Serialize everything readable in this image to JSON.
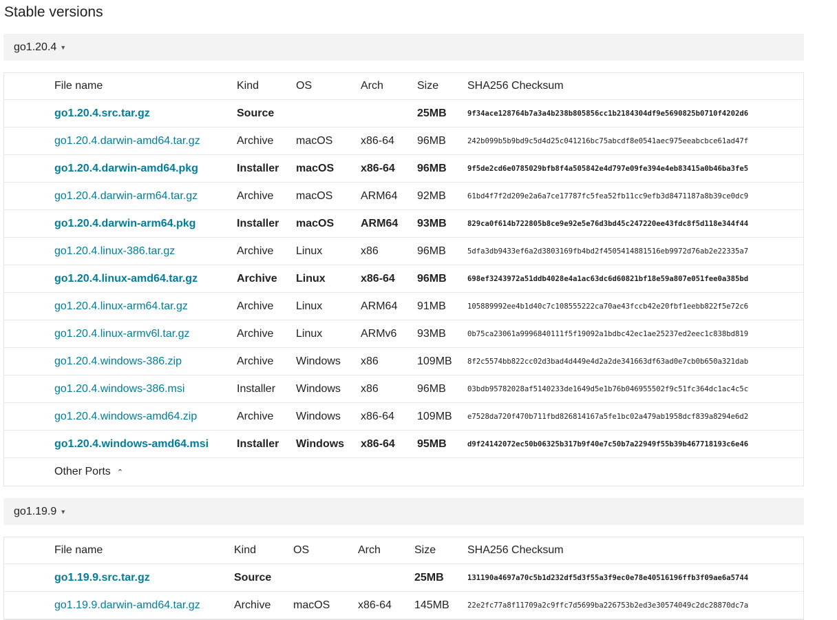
{
  "page_title": "Stable versions",
  "releases": [
    {
      "version": "go1.20.4",
      "columns": [
        "File name",
        "Kind",
        "OS",
        "Arch",
        "Size",
        "SHA256 Checksum"
      ],
      "files": [
        {
          "name": "go1.20.4.src.tar.gz",
          "kind": "Source",
          "os": "",
          "arch": "",
          "size": "25MB",
          "sha": "9f34ace128764b7a3a4b238b805856cc1b2184304df9e5690825b0710f4202d6",
          "featured": true
        },
        {
          "name": "go1.20.4.darwin-amd64.tar.gz",
          "kind": "Archive",
          "os": "macOS",
          "arch": "x86-64",
          "size": "96MB",
          "sha": "242b099b5b9bd9c5d4d25c041216bc75abcdf8e0541aec975eeabcbce61ad47f",
          "featured": false
        },
        {
          "name": "go1.20.4.darwin-amd64.pkg",
          "kind": "Installer",
          "os": "macOS",
          "arch": "x86-64",
          "size": "96MB",
          "sha": "9f5de2cd6e0785029bfb8f4a505842e4d797e09fe394e4eb83415a0b46ba3fe5",
          "featured": true
        },
        {
          "name": "go1.20.4.darwin-arm64.tar.gz",
          "kind": "Archive",
          "os": "macOS",
          "arch": "ARM64",
          "size": "92MB",
          "sha": "61bd4f7f2d209e2a6a7ce17787fc5fea52fb11cc9efb3d8471187a8b39ce0dc9",
          "featured": false
        },
        {
          "name": "go1.20.4.darwin-arm64.pkg",
          "kind": "Installer",
          "os": "macOS",
          "arch": "ARM64",
          "size": "93MB",
          "sha": "829ca0f614b722805b8ce9e92e5e76d3bd45c247220ee43fdc8f5d118e344f44",
          "featured": true
        },
        {
          "name": "go1.20.4.linux-386.tar.gz",
          "kind": "Archive",
          "os": "Linux",
          "arch": "x86",
          "size": "96MB",
          "sha": "5dfa3db9433ef6a2d3803169fb4bd2f4505414881516eb9972d76ab2e22335a7",
          "featured": false
        },
        {
          "name": "go1.20.4.linux-amd64.tar.gz",
          "kind": "Archive",
          "os": "Linux",
          "arch": "x86-64",
          "size": "96MB",
          "sha": "698ef3243972a51ddb4028e4a1ac63dc6d60821bf18e59a807e051fee0a385bd",
          "featured": true
        },
        {
          "name": "go1.20.4.linux-arm64.tar.gz",
          "kind": "Archive",
          "os": "Linux",
          "arch": "ARM64",
          "size": "91MB",
          "sha": "105889992ee4b1d40c7c108555222ca70ae43fccb42e20fbf1eebb822f5e72c6",
          "featured": false
        },
        {
          "name": "go1.20.4.linux-armv6l.tar.gz",
          "kind": "Archive",
          "os": "Linux",
          "arch": "ARMv6",
          "size": "93MB",
          "sha": "0b75ca23061a9996840111f5f19092a1bdbc42ec1ae25237ed2eec1c838bd819",
          "featured": false
        },
        {
          "name": "go1.20.4.windows-386.zip",
          "kind": "Archive",
          "os": "Windows",
          "arch": "x86",
          "size": "109MB",
          "sha": "8f2c5574bb822cc02d3bad4d449e4d2a2de341663df63ad0e7cb0b650a321dab",
          "featured": false
        },
        {
          "name": "go1.20.4.windows-386.msi",
          "kind": "Installer",
          "os": "Windows",
          "arch": "x86",
          "size": "96MB",
          "sha": "03bdb95782028af5140233de1649d5e1b76b046955502f9c51fc364dc1ac4c5c",
          "featured": false
        },
        {
          "name": "go1.20.4.windows-amd64.zip",
          "kind": "Archive",
          "os": "Windows",
          "arch": "x86-64",
          "size": "109MB",
          "sha": "e7528da720f470b711fbd826814167a5fe1bc02a479ab1958dcf839a8294e6d2",
          "featured": false
        },
        {
          "name": "go1.20.4.windows-amd64.msi",
          "kind": "Installer",
          "os": "Windows",
          "arch": "x86-64",
          "size": "95MB",
          "sha": "d9f24142072ec50b06325b317b9f40e7c50b7a22949f55b39b467718193c6e46",
          "featured": true
        }
      ],
      "other_ports_label": "Other Ports"
    },
    {
      "version": "go1.19.9",
      "columns": [
        "File name",
        "Kind",
        "OS",
        "Arch",
        "Size",
        "SHA256 Checksum"
      ],
      "files": [
        {
          "name": "go1.19.9.src.tar.gz",
          "kind": "Source",
          "os": "",
          "arch": "",
          "size": "25MB",
          "sha": "131190a4697a70c5b1d232df5d3f55a3f9ec0e78e40516196ffb3f09ae6a5744",
          "featured": true
        },
        {
          "name": "go1.19.9.darwin-amd64.tar.gz",
          "kind": "Archive",
          "os": "macOS",
          "arch": "x86-64",
          "size": "145MB",
          "sha": "22e2fc77a8f11709a2c9ffc7d5699ba226753b2ed3e30574049c2dc28870dc7a",
          "featured": false
        }
      ]
    }
  ]
}
